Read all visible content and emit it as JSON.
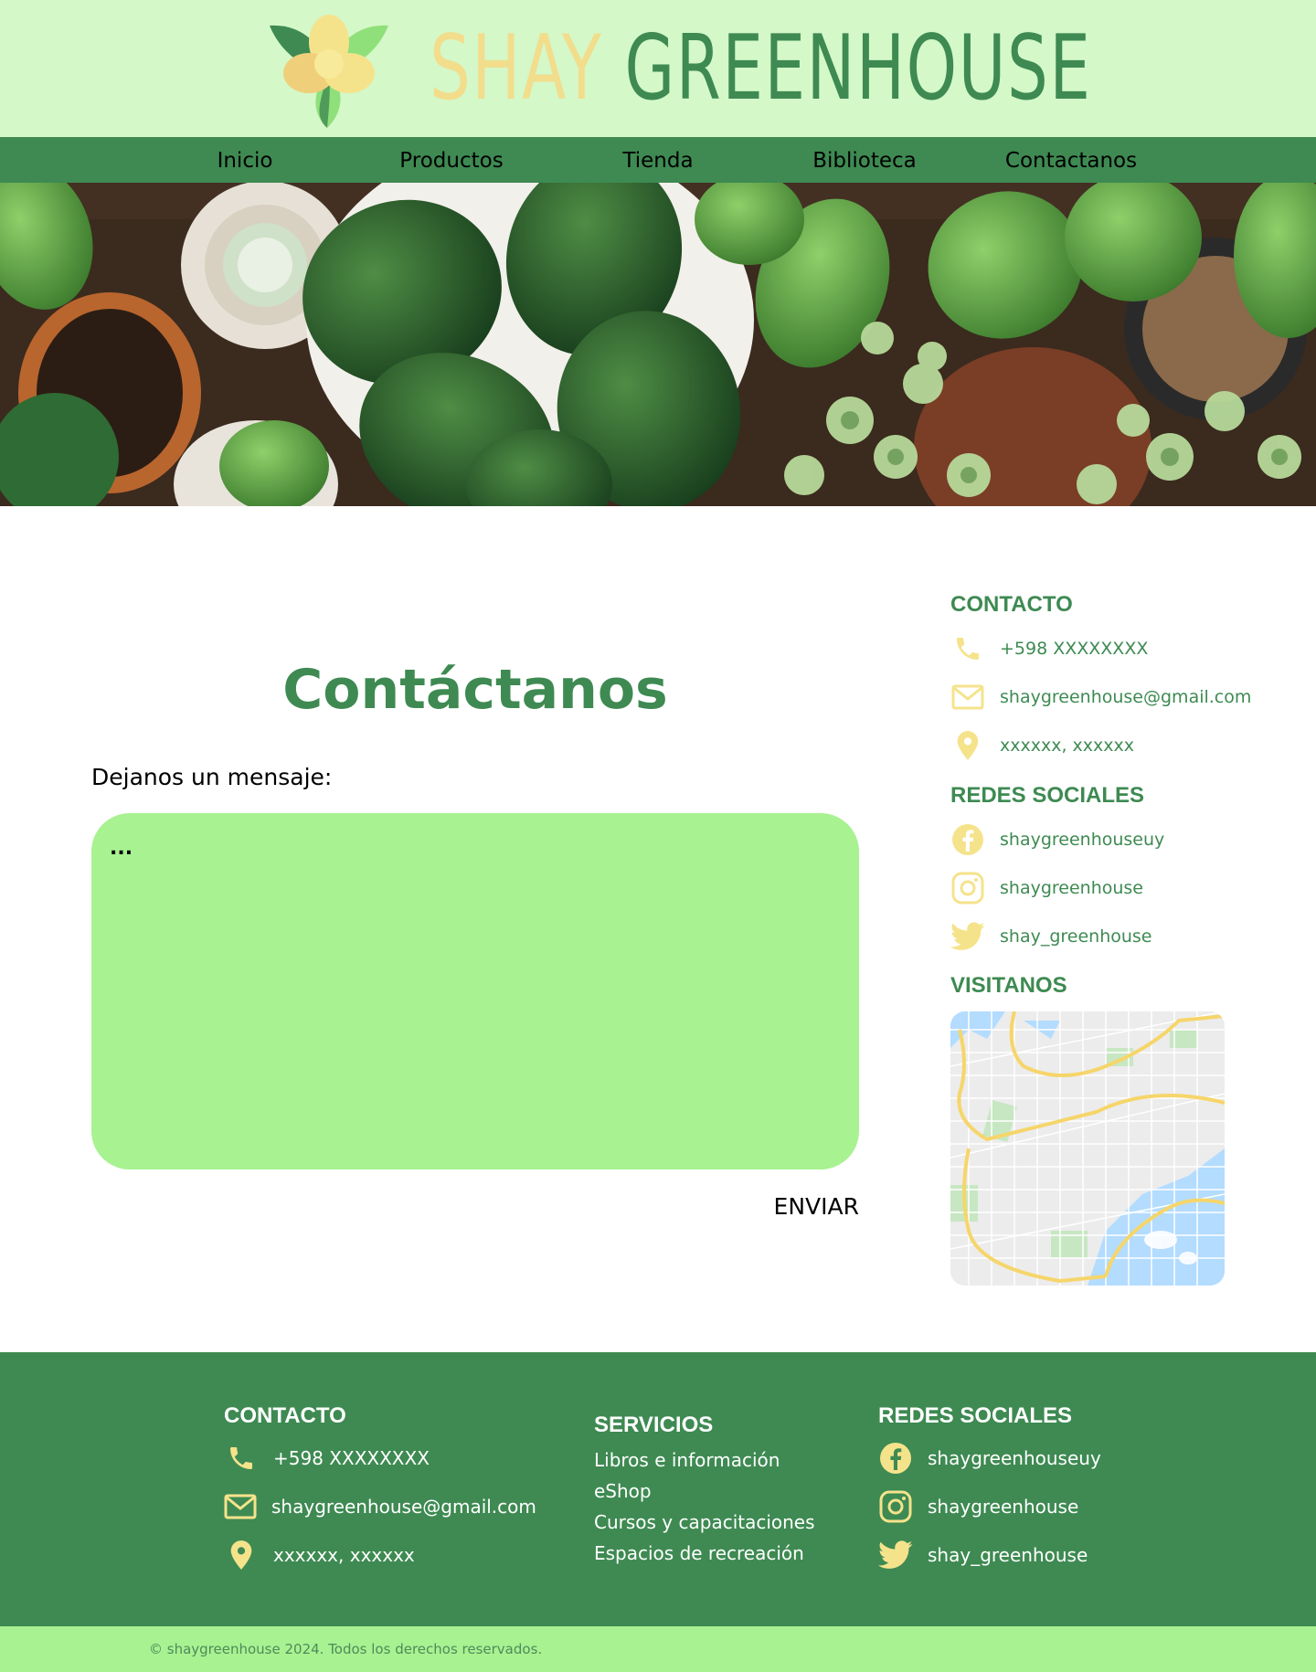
{
  "brand": {
    "part1": "SHAY",
    "part2": "GREENHOUSE"
  },
  "nav": [
    {
      "label": "Inicio"
    },
    {
      "label": "Productos"
    },
    {
      "label": "Tienda"
    },
    {
      "label": "Biblioteca"
    },
    {
      "label": "Contactanos"
    }
  ],
  "main": {
    "title": "Contáctanos",
    "message_label": "Dejanos un mensaje:",
    "message_placeholder": "...",
    "send_label": "ENVIAR"
  },
  "sidebar": {
    "contact_heading": "CONTACTO",
    "phone": "+598 XXXXXXXX",
    "email": "shaygreenhouse@gmail.com",
    "address": "xxxxxx, xxxxxx",
    "social_heading": "REDES SOCIALES",
    "facebook": "shaygreenhouseuy",
    "instagram": "shaygreenhouse",
    "twitter": "shay_greenhouse",
    "visit_heading": "VISITANOS"
  },
  "footer": {
    "contact_heading": "CONTACTO",
    "phone": "+598 XXXXXXXX",
    "email": "shaygreenhouse@gmail.com",
    "address": "xxxxxx, xxxxxx",
    "services_heading": "SERVICIOS",
    "services": [
      {
        "label": "Libros e información"
      },
      {
        "label": "eShop"
      },
      {
        "label": "Cursos y capacitaciones"
      },
      {
        "label": "Espacios de recreación"
      }
    ],
    "social_heading": "REDES SOCIALES",
    "facebook": "shaygreenhouseuy",
    "instagram": "shaygreenhouse",
    "twitter": "shay_greenhouse",
    "copyright": "© shaygreenhouse 2024. Todos los derechos reservados."
  },
  "colors": {
    "header_bg": "#d4f8c8",
    "brand_green": "#3e8a52",
    "brand_yellow": "#f2dd8c",
    "message_box": "#a8f291",
    "icon_yellow": "#f5e38c"
  },
  "icons": {
    "logo": "flower-logo-icon",
    "phone": "phone-icon",
    "email": "mail-icon",
    "address": "location-pin-icon",
    "facebook": "facebook-icon",
    "instagram": "instagram-icon",
    "twitter": "twitter-icon"
  }
}
